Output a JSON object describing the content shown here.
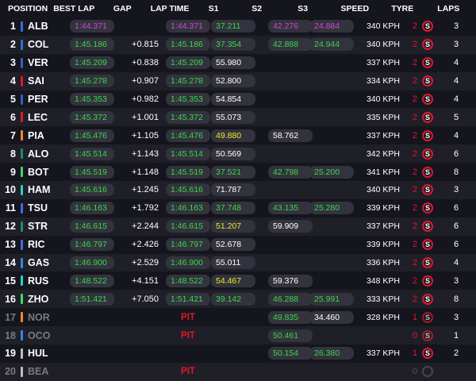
{
  "headers": {
    "position": "POSITION",
    "best_lap": "BEST LAP",
    "gap": "GAP",
    "lap_time": "LAP TIME",
    "s1": "S1",
    "s2": "S2",
    "s3": "S3",
    "speed": "SPEED",
    "tyre": "TYRE",
    "laps": "LAPS"
  },
  "colors": {
    "purple": "#d445d8",
    "green": "#39d84a",
    "yellow": "#ecec2a",
    "red": "#e0182a"
  },
  "tyre_icon_letter": "S",
  "rows": [
    {
      "pos": "1",
      "drv": "ALB",
      "team": "#2f6fd8",
      "best": "1:44.371",
      "best_c": "purple",
      "gap": "",
      "lap": "1:44.371",
      "lap_c": "purple",
      "s1": "37.211",
      "s1_c": "green",
      "s2": "42.276",
      "s2_c": "purple",
      "s3": "24.884",
      "s3_c": "purple",
      "speed": "340 KPH",
      "tyre": "2",
      "laps": "3"
    },
    {
      "pos": "2",
      "drv": "COL",
      "team": "#2f6fd8",
      "best": "1:45.186",
      "best_c": "green",
      "gap": "+0.815",
      "lap": "1:45.186",
      "lap_c": "green",
      "s1": "37.354",
      "s1_c": "green",
      "s2": "42.888",
      "s2_c": "green",
      "s3": "24.944",
      "s3_c": "green",
      "speed": "340 KPH",
      "tyre": "2",
      "laps": "3"
    },
    {
      "pos": "3",
      "drv": "VER",
      "team": "#3a5cc4",
      "best": "1:45.209",
      "best_c": "green",
      "gap": "+0.838",
      "lap": "1:45.209",
      "lap_c": "green",
      "s1": "55.980",
      "s1_c": "white",
      "s2": "",
      "s2_c": "empty",
      "s3": "",
      "s3_c": "empty",
      "speed": "337 KPH",
      "tyre": "2",
      "laps": "4"
    },
    {
      "pos": "4",
      "drv": "SAI",
      "team": "#e0182a",
      "best": "1:45.278",
      "best_c": "green",
      "gap": "+0.907",
      "lap": "1:45.278",
      "lap_c": "green",
      "s1": "52.800",
      "s1_c": "white",
      "s2": "",
      "s2_c": "empty",
      "s3": "",
      "s3_c": "empty",
      "speed": "334 KPH",
      "tyre": "2",
      "laps": "4"
    },
    {
      "pos": "5",
      "drv": "PER",
      "team": "#3a5cc4",
      "best": "1:45.353",
      "best_c": "green",
      "gap": "+0.982",
      "lap": "1:45.353",
      "lap_c": "green",
      "s1": "54.854",
      "s1_c": "white",
      "s2": "",
      "s2_c": "empty",
      "s3": "",
      "s3_c": "empty",
      "speed": "340 KPH",
      "tyre": "2",
      "laps": "4"
    },
    {
      "pos": "6",
      "drv": "LEC",
      "team": "#e0182a",
      "best": "1:45.372",
      "best_c": "green",
      "gap": "+1.001",
      "lap": "1:45.372",
      "lap_c": "green",
      "s1": "55.073",
      "s1_c": "white",
      "s2": "",
      "s2_c": "empty",
      "s3": "",
      "s3_c": "empty",
      "speed": "335 KPH",
      "tyre": "2",
      "laps": "5"
    },
    {
      "pos": "7",
      "drv": "PIA",
      "team": "#f5842a",
      "best": "1:45.476",
      "best_c": "green",
      "gap": "+1.105",
      "lap": "1:45.476",
      "lap_c": "green",
      "s1": "49.880",
      "s1_c": "yellow",
      "s2": "58.762",
      "s2_c": "white",
      "s3": "",
      "s3_c": "empty",
      "speed": "337 KPH",
      "tyre": "2",
      "laps": "4"
    },
    {
      "pos": "8",
      "drv": "ALO",
      "team": "#1f8a6c",
      "best": "1:45.514",
      "best_c": "green",
      "gap": "+1.143",
      "lap": "1:45.514",
      "lap_c": "green",
      "s1": "50.569",
      "s1_c": "white",
      "s2": "",
      "s2_c": "empty",
      "s3": "",
      "s3_c": "empty",
      "speed": "342 KPH",
      "tyre": "2",
      "laps": "6"
    },
    {
      "pos": "9",
      "drv": "BOT",
      "team": "#3fd86a",
      "best": "1:45.519",
      "best_c": "green",
      "gap": "+1.148",
      "lap": "1:45.519",
      "lap_c": "green",
      "s1": "37.521",
      "s1_c": "green",
      "s2": "42.798",
      "s2_c": "green",
      "s3": "25.200",
      "s3_c": "green",
      "speed": "341 KPH",
      "tyre": "2",
      "laps": "8"
    },
    {
      "pos": "10",
      "drv": "HAM",
      "team": "#27d2c0",
      "best": "1:45.616",
      "best_c": "green",
      "gap": "+1.245",
      "lap": "1:45.616",
      "lap_c": "green",
      "s1": "71.787",
      "s1_c": "white",
      "s2": "",
      "s2_c": "empty",
      "s3": "",
      "s3_c": "empty",
      "speed": "340 KPH",
      "tyre": "2",
      "laps": "3"
    },
    {
      "pos": "11",
      "drv": "TSU",
      "team": "#4a6ad8",
      "best": "1:46.163",
      "best_c": "green",
      "gap": "+1.792",
      "lap": "1:46.163",
      "lap_c": "green",
      "s1": "37.748",
      "s1_c": "green",
      "s2": "43.135",
      "s2_c": "green",
      "s3": "25.280",
      "s3_c": "green",
      "speed": "339 KPH",
      "tyre": "2",
      "laps": "6"
    },
    {
      "pos": "12",
      "drv": "STR",
      "team": "#1f8a6c",
      "best": "1:46.615",
      "best_c": "green",
      "gap": "+2.244",
      "lap": "1:46.615",
      "lap_c": "green",
      "s1": "51.207",
      "s1_c": "yellow",
      "s2": "59.909",
      "s2_c": "white",
      "s3": "",
      "s3_c": "empty",
      "speed": "337 KPH",
      "tyre": "2",
      "laps": "6"
    },
    {
      "pos": "13",
      "drv": "RIC",
      "team": "#4a6ad8",
      "best": "1:46.797",
      "best_c": "green",
      "gap": "+2.426",
      "lap": "1:46.797",
      "lap_c": "green",
      "s1": "52.678",
      "s1_c": "white",
      "s2": "",
      "s2_c": "empty",
      "s3": "",
      "s3_c": "empty",
      "speed": "339 KPH",
      "tyre": "2",
      "laps": "6"
    },
    {
      "pos": "14",
      "drv": "GAS",
      "team": "#2f8ae0",
      "best": "1:46.900",
      "best_c": "green",
      "gap": "+2.529",
      "lap": "1:46.900",
      "lap_c": "green",
      "s1": "55.011",
      "s1_c": "white",
      "s2": "",
      "s2_c": "empty",
      "s3": "",
      "s3_c": "empty",
      "speed": "336 KPH",
      "tyre": "2",
      "laps": "4"
    },
    {
      "pos": "15",
      "drv": "RUS",
      "team": "#27d2c0",
      "best": "1:48.522",
      "best_c": "green",
      "gap": "+4.151",
      "lap": "1:48.522",
      "lap_c": "green",
      "s1": "54.467",
      "s1_c": "yellow",
      "s2": "59.376",
      "s2_c": "white",
      "s3": "",
      "s3_c": "empty",
      "speed": "348 KPH",
      "tyre": "2",
      "laps": "3"
    },
    {
      "pos": "16",
      "drv": "ZHO",
      "team": "#3fd86a",
      "best": "1:51.421",
      "best_c": "green",
      "gap": "+7.050",
      "lap": "1:51.421",
      "lap_c": "green",
      "s1": "39.142",
      "s1_c": "green",
      "s2": "46.288",
      "s2_c": "green",
      "s3": "25.991",
      "s3_c": "green",
      "speed": "333 KPH",
      "tyre": "2",
      "laps": "8"
    },
    {
      "pos": "17",
      "drv": "NOR",
      "team": "#f5842a",
      "dim": true,
      "pit": "PIT",
      "s1": "",
      "s2": "49.835",
      "s2_c": "green",
      "s3": "34.460",
      "s3_c": "white",
      "speed": "328 KPH",
      "tyre": "1",
      "laps": "3"
    },
    {
      "pos": "18",
      "drv": "OCO",
      "team": "#2f8ae0",
      "dim": true,
      "pit": "PIT",
      "s1": "",
      "s2": "50.461",
      "s2_c": "green",
      "s3": "",
      "s3_c": "empty",
      "speed": "",
      "tyre": "0",
      "laps": "1"
    },
    {
      "pos": "19",
      "drv": "HUL",
      "team": "#bfbfbf",
      "pit": "",
      "s1": "",
      "s2": "50.154",
      "s2_c": "green",
      "s3": "26.380",
      "s3_c": "green",
      "speed": "337 KPH",
      "tyre": "1",
      "laps": "2"
    },
    {
      "pos": "20",
      "drv": "BEA",
      "team": "#bfbfbf",
      "dim": true,
      "last": true,
      "pit": "PIT",
      "s1": "",
      "s2": "",
      "s2_c": "empty",
      "s3": "",
      "s3_c": "empty",
      "speed": "",
      "tyre": "0",
      "laps": ""
    }
  ]
}
